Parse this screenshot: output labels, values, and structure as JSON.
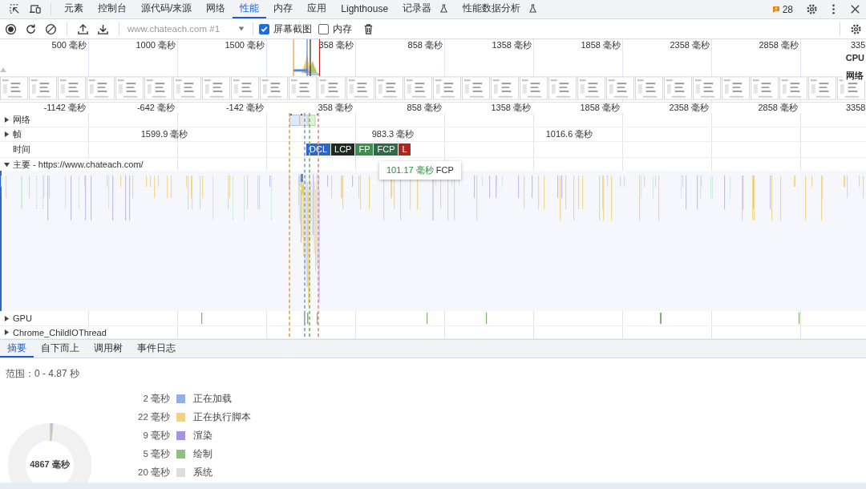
{
  "tabs": [
    {
      "label": "元素",
      "selected": false,
      "experimental": false
    },
    {
      "label": "控制台",
      "selected": false,
      "experimental": false
    },
    {
      "label": "源代码/来源",
      "selected": false,
      "experimental": false
    },
    {
      "label": "网络",
      "selected": false,
      "experimental": false
    },
    {
      "label": "性能",
      "selected": true,
      "experimental": false
    },
    {
      "label": "内存",
      "selected": false,
      "experimental": false
    },
    {
      "label": "应用",
      "selected": false,
      "experimental": false
    },
    {
      "label": "Lighthouse",
      "selected": false,
      "experimental": false
    },
    {
      "label": "记录器",
      "selected": false,
      "experimental": true
    },
    {
      "label": "性能数据分析",
      "selected": false,
      "experimental": true
    }
  ],
  "issues_count": "28",
  "toolbar": {
    "target": "www.chateach.com #1",
    "screenshots": {
      "label": "屏幕截图",
      "checked": true
    },
    "memory": {
      "label": "内存",
      "checked": false
    }
  },
  "overview": {
    "ticks": [
      "500 毫秒",
      "1000 毫秒",
      "1500 毫秒",
      "358 毫秒",
      "858 毫秒",
      "1358 毫秒",
      "1858 毫秒",
      "2358 毫秒",
      "2858 毫秒",
      "335"
    ],
    "lanes": [
      "CPU",
      "网络"
    ]
  },
  "ruler": {
    "ticks": [
      "-1142 毫秒",
      "-642 毫秒",
      "-142 毫秒",
      "358 毫秒",
      "858 毫秒",
      "1358 毫秒",
      "1858 毫秒",
      "2358 毫秒",
      "2858 毫秒",
      "3358"
    ]
  },
  "tracks": {
    "network": {
      "label": "网络",
      "expanded": false
    },
    "frames": {
      "label": "帧",
      "expanded": false,
      "durations": [
        "1599.9 毫秒",
        "983.3 毫秒",
        "1016.6 毫秒"
      ]
    },
    "timings": {
      "label": "时间",
      "markers": [
        {
          "label": "DCL",
          "color": "#2f66c8"
        },
        {
          "label": "LCP",
          "color": "#1d2b22"
        },
        {
          "label": "FP",
          "color": "#3f8f4c"
        },
        {
          "label": "FCP",
          "color": "#2f6b49"
        },
        {
          "label": "L",
          "color": "#b0261c"
        }
      ]
    },
    "main": {
      "label": "主要 - https://www.chateach.com/",
      "expanded": true
    },
    "gpu": {
      "label": "GPU",
      "expanded": false
    },
    "io": {
      "label": "Chrome_ChildIOThread",
      "expanded": false
    }
  },
  "tooltip": {
    "time": "101.17 毫秒",
    "label": "FCP"
  },
  "bottom_tabs": [
    {
      "label": "摘要",
      "selected": true
    },
    {
      "label": "自下而上",
      "selected": false
    },
    {
      "label": "调用树",
      "selected": false
    },
    {
      "label": "事件日志",
      "selected": false
    }
  ],
  "summary": {
    "range": "范围：0 - 4.87 秒",
    "total": "4867 毫秒",
    "categories": [
      {
        "value": "2 毫秒",
        "label": "正在加载",
        "color": "#8fb1e6"
      },
      {
        "value": "22 毫秒",
        "label": "正在执行脚本",
        "color": "#f1d37e"
      },
      {
        "value": "9 毫秒",
        "label": "渲染",
        "color": "#a892e0"
      },
      {
        "value": "5 毫秒",
        "label": "绘制",
        "color": "#8fc07f"
      },
      {
        "value": "20 毫秒",
        "label": "系统",
        "color": "#dddddd"
      }
    ]
  }
}
